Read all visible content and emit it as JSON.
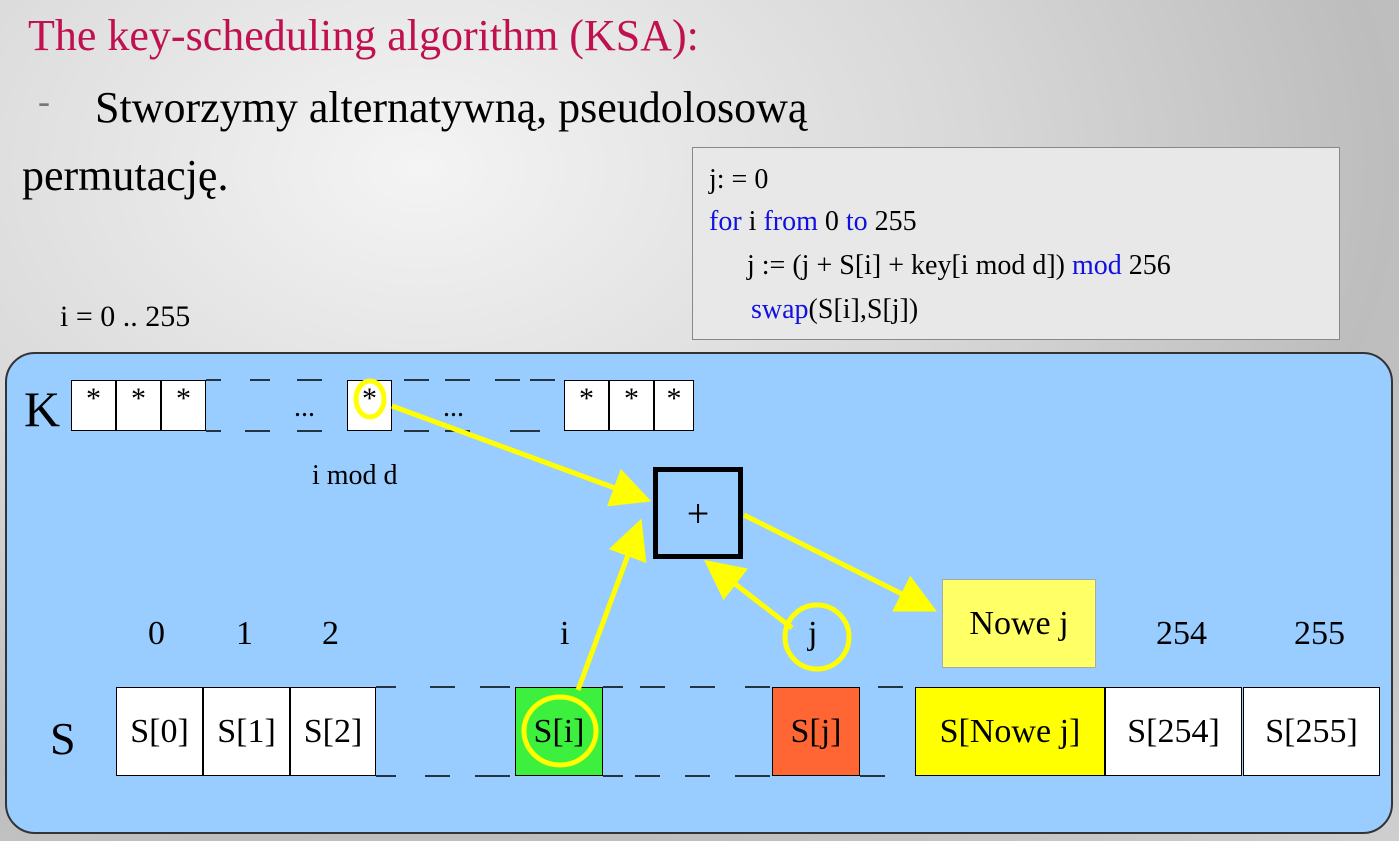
{
  "title": "The key-scheduling algorithm (KSA):",
  "bullet_line1": "Stworzymy alternatywną, pseudolosową",
  "bullet_line2": "permutację.",
  "code": {
    "line1": "j: = 0",
    "line2_kw1": "for",
    "line2_t1": " i ",
    "line2_kw2": "from",
    "line2_t2": " 0 ",
    "line2_kw3": "to",
    "line2_t3": " 255",
    "line3_t": "j := (j + S[i] + key[i mod d]) ",
    "line3_kw": "mod",
    "line3_t2": " 256",
    "line4_kw": "swap",
    "line4_t": "(S[i],S[j])"
  },
  "range_label": "i = 0 .. 255",
  "diagram": {
    "k_label": "K",
    "s_label": "S",
    "key_cell": "*",
    "ellipsis": "...",
    "i_mod_d": "i mod d",
    "plus": "+",
    "new_j": "Nowe j",
    "idx": {
      "0": "0",
      "1": "1",
      "2": "2",
      "i": "i",
      "j": "j",
      "254": "254",
      "255": "255"
    },
    "s_cells": {
      "s0": "S[0]",
      "s1": "S[1]",
      "s2": "S[2]",
      "si": "S[i]",
      "sj": "S[j]",
      "snew": "S[Nowe j]",
      "s254": "S[254]",
      "s255": "S[255]"
    },
    "colors": {
      "panel": "#99ccff",
      "si": "#3ef03e",
      "sj": "#ff6633",
      "snew": "#ffff00",
      "new_j_box": "#ffff66",
      "arrow": "#ffff00"
    }
  }
}
